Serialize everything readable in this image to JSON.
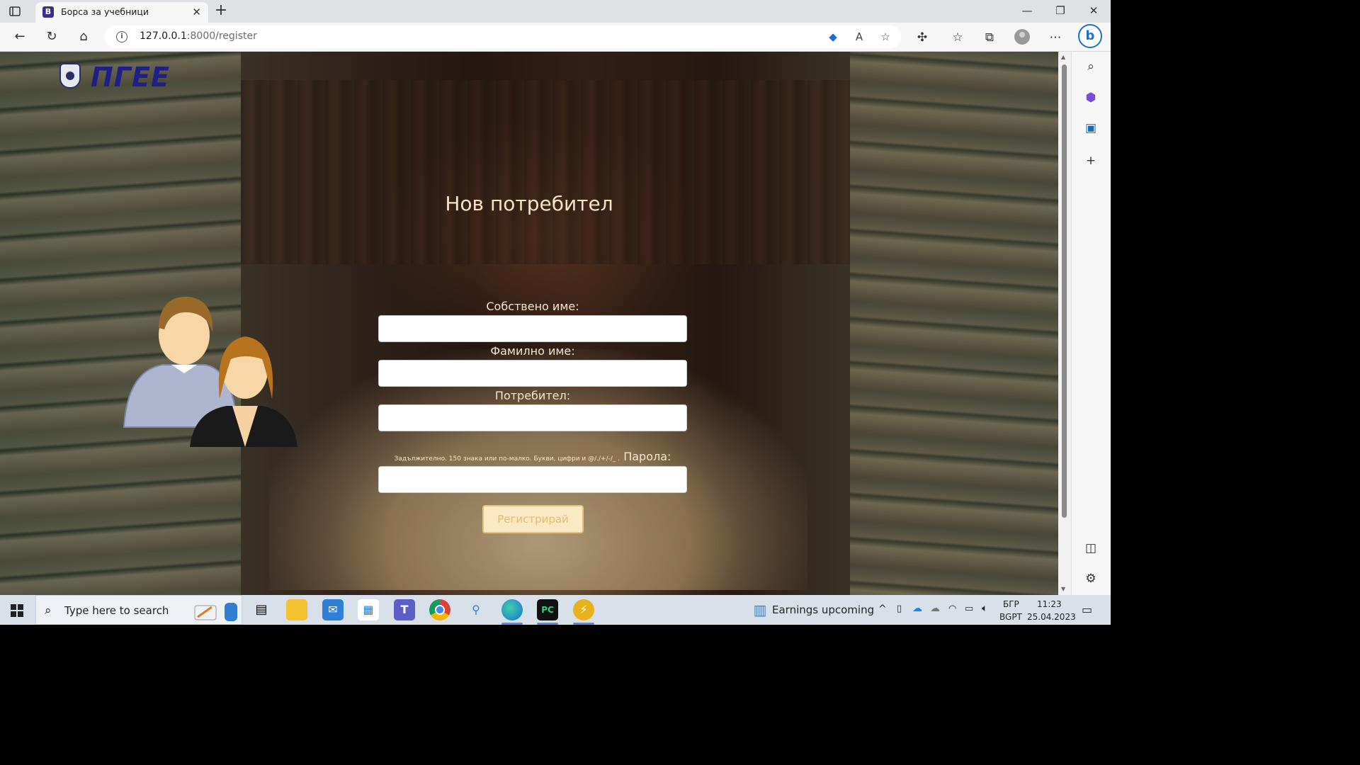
{
  "browser": {
    "tab_title": "Борса за учебници",
    "tab_favicon_letter": "B",
    "url_host": "127.0.0.1",
    "url_rest": ":8000/register"
  },
  "page": {
    "logo_text": "ПГЕЕ",
    "heading": "Нов потребител",
    "form": {
      "first_name_label": "Собствено име:",
      "last_name_label": "Фамилно име:",
      "username_label": "Потребител:",
      "username_hint": "Задължително. 150 знака или по-малко. Букви, цифри и @/./+/-/_ .",
      "password_label": "Парола:",
      "submit_label": "Регистрирай"
    }
  },
  "taskbar": {
    "search_placeholder": "Type here to search",
    "widget_text": "Earnings upcoming",
    "lang_top": "БГР",
    "lang_bottom": "BGPT",
    "time": "11:23",
    "date": "25.04.2023"
  },
  "icons": [
    "sidebar-icon",
    "back-icon",
    "refresh-icon",
    "home-icon",
    "info-icon",
    "tag-icon",
    "read-aloud-icon",
    "favorite-add-icon",
    "extensions-icon",
    "favorites-icon",
    "collections-icon",
    "profile-icon",
    "more-icon",
    "bing-icon",
    "search-icon",
    "copilot-icon",
    "outlook-icon",
    "add-icon",
    "split-screen-icon",
    "settings-icon"
  ]
}
